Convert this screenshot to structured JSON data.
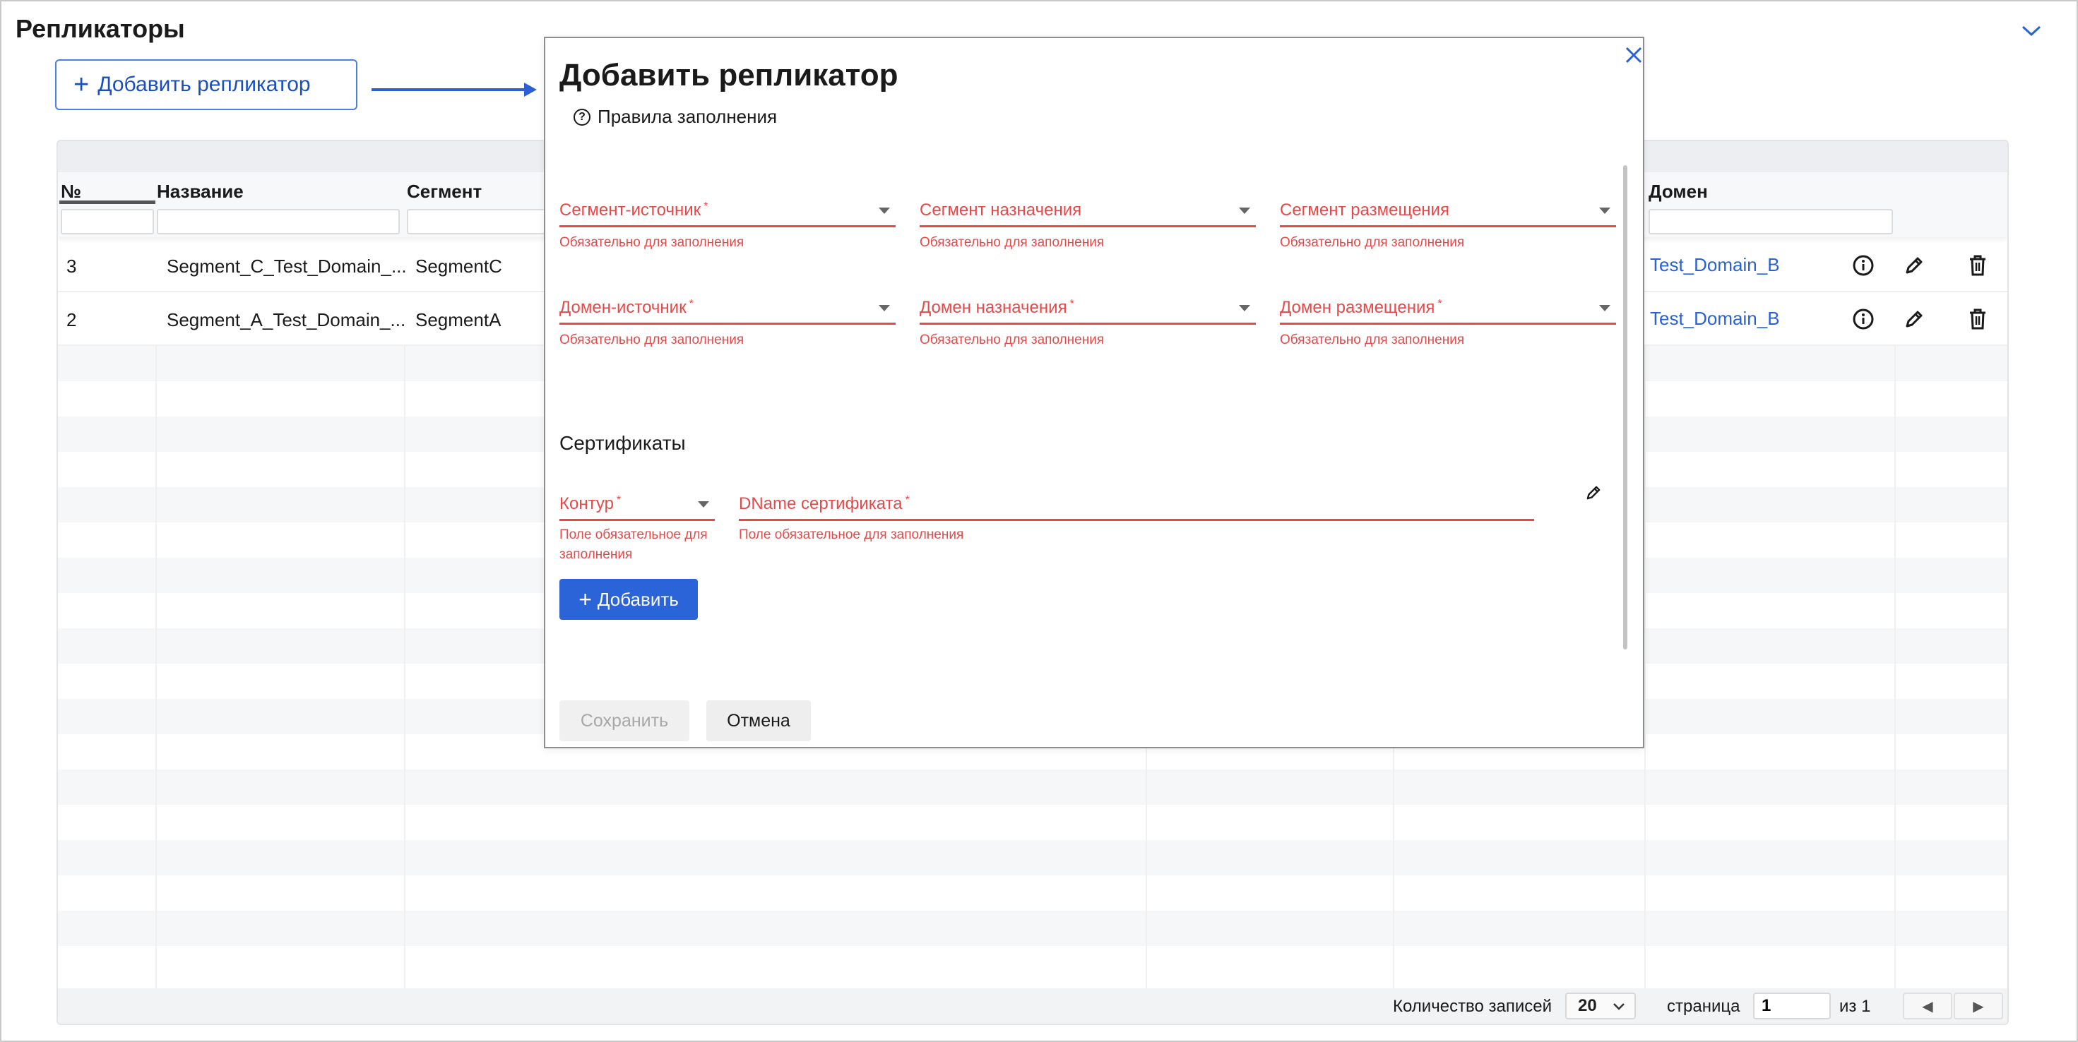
{
  "page": {
    "title": "Репликаторы",
    "add_button_label": "Добавить репликатор"
  },
  "table": {
    "columns": {
      "num": "№",
      "name": "Название",
      "segment": "Сегмент",
      "domain": "Домен"
    },
    "rows": [
      {
        "num": "3",
        "name": "Segment_C_Test_Domain_...",
        "segment": "SegmentC",
        "domain": "Test_Domain_B"
      },
      {
        "num": "2",
        "name": "Segment_A_Test_Domain_...",
        "segment": "SegmentA",
        "domain": "Test_Domain_B"
      }
    ],
    "footer": {
      "records_label": "Количество записей",
      "records_value": "20",
      "page_label": "страница",
      "page_value": "1",
      "of_label": "из 1"
    }
  },
  "modal": {
    "title": "Добавить репликатор",
    "rules_link": "Правила заполнения",
    "fields": {
      "source_segment": {
        "label": "Сегмент-источник",
        "required": "*",
        "error": "Обязательно для заполнения"
      },
      "target_segment": {
        "label": "Сегмент назначения",
        "required": "",
        "error": "Обязательно для заполнения"
      },
      "placement_segment": {
        "label": "Сегмент размещения",
        "required": "",
        "error": "Обязательно для заполнения"
      },
      "source_domain": {
        "label": "Домен-источник",
        "required": "*",
        "error": "Обязательно для заполнения"
      },
      "target_domain": {
        "label": "Домен назначения",
        "required": "*",
        "error": "Обязательно для заполнения"
      },
      "placement_domain": {
        "label": "Домен размещения",
        "required": "*",
        "error": "Обязательно для заполнения"
      }
    },
    "certificates": {
      "title": "Сертификаты",
      "contour": {
        "label": "Контур",
        "required": "*",
        "error_line1": "Поле обязательное для",
        "error_line2": "заполнения"
      },
      "dname": {
        "label": "DName сертификата",
        "required": "*",
        "error": "Поле обязательное для заполнения"
      },
      "add_button": "Добавить"
    },
    "save_button": "Сохранить",
    "cancel_button": "Отмена"
  },
  "colors": {
    "accent": "#2b63d9",
    "error": "#e84848",
    "link": "#2a62d6"
  }
}
